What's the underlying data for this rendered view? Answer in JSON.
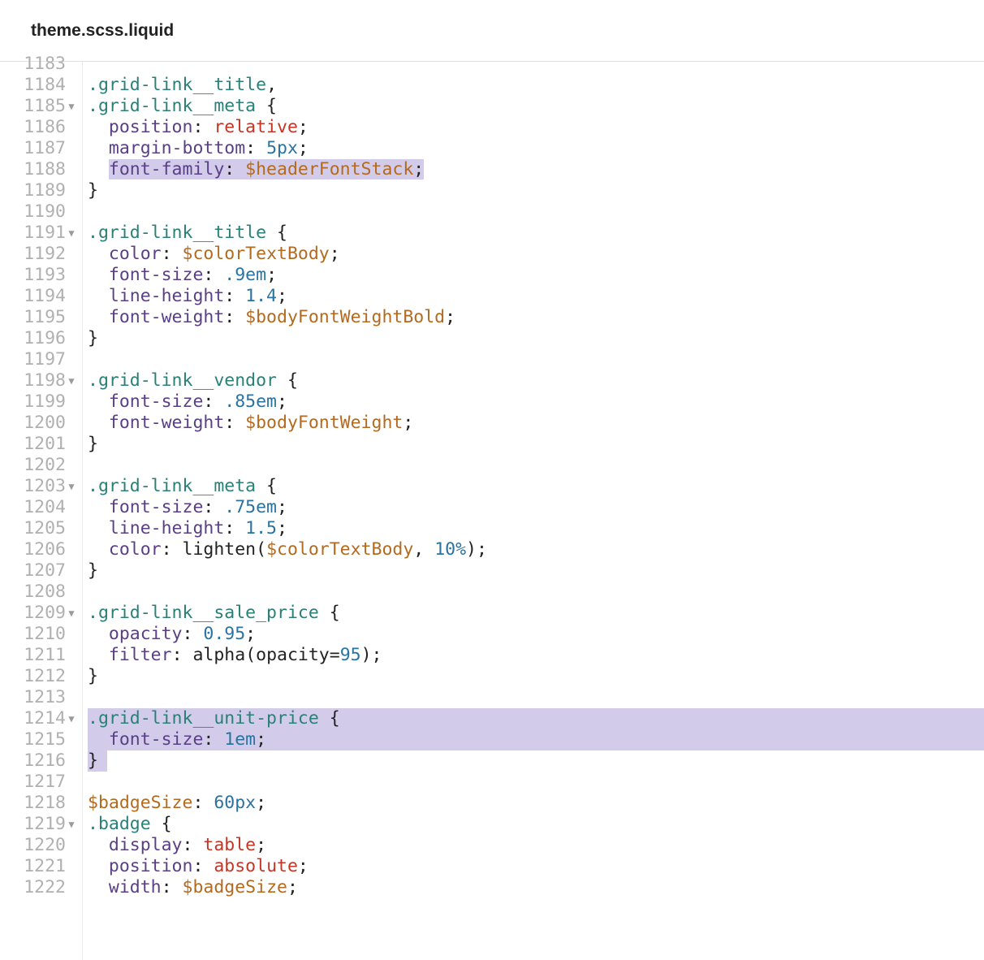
{
  "tab": {
    "title": "theme.scss.liquid"
  },
  "lines": [
    {
      "num": "1183",
      "fold": false,
      "cutTop": true,
      "tokens": []
    },
    {
      "num": "1184",
      "fold": false,
      "tokens": [
        {
          "t": ".grid-link__title",
          "c": "c-sel"
        },
        {
          "t": ",",
          "c": "c-punc"
        }
      ]
    },
    {
      "num": "1185",
      "fold": true,
      "tokens": [
        {
          "t": ".grid-link__meta",
          "c": "c-sel"
        },
        {
          "t": " {",
          "c": "c-punc"
        }
      ]
    },
    {
      "num": "1186",
      "fold": false,
      "tokens": [
        {
          "t": "  ",
          "c": ""
        },
        {
          "t": "position",
          "c": "c-prop"
        },
        {
          "t": ": ",
          "c": "c-punc"
        },
        {
          "t": "relative",
          "c": "c-kw"
        },
        {
          "t": ";",
          "c": "c-punc"
        }
      ]
    },
    {
      "num": "1187",
      "fold": false,
      "tokens": [
        {
          "t": "  ",
          "c": ""
        },
        {
          "t": "margin-bottom",
          "c": "c-prop"
        },
        {
          "t": ": ",
          "c": "c-punc"
        },
        {
          "t": "5px",
          "c": "c-num"
        },
        {
          "t": ";",
          "c": "c-punc"
        }
      ]
    },
    {
      "num": "1188",
      "fold": false,
      "hlInline": true,
      "tokens": [
        {
          "t": "  ",
          "c": ""
        },
        {
          "t": "font-family",
          "c": "c-prop",
          "hl": true
        },
        {
          "t": ": ",
          "c": "c-punc",
          "hl": true
        },
        {
          "t": "$headerFontStack",
          "c": "c-var",
          "hl": true
        },
        {
          "t": ";",
          "c": "c-punc",
          "hl": true
        }
      ]
    },
    {
      "num": "1189",
      "fold": false,
      "tokens": [
        {
          "t": "}",
          "c": "c-punc"
        }
      ]
    },
    {
      "num": "1190",
      "fold": false,
      "tokens": []
    },
    {
      "num": "1191",
      "fold": true,
      "tokens": [
        {
          "t": ".grid-link__title",
          "c": "c-sel"
        },
        {
          "t": " {",
          "c": "c-punc"
        }
      ]
    },
    {
      "num": "1192",
      "fold": false,
      "tokens": [
        {
          "t": "  ",
          "c": ""
        },
        {
          "t": "color",
          "c": "c-prop"
        },
        {
          "t": ": ",
          "c": "c-punc"
        },
        {
          "t": "$colorTextBody",
          "c": "c-var"
        },
        {
          "t": ";",
          "c": "c-punc"
        }
      ]
    },
    {
      "num": "1193",
      "fold": false,
      "tokens": [
        {
          "t": "  ",
          "c": ""
        },
        {
          "t": "font-size",
          "c": "c-prop"
        },
        {
          "t": ": ",
          "c": "c-punc"
        },
        {
          "t": ".9em",
          "c": "c-num"
        },
        {
          "t": ";",
          "c": "c-punc"
        }
      ]
    },
    {
      "num": "1194",
      "fold": false,
      "tokens": [
        {
          "t": "  ",
          "c": ""
        },
        {
          "t": "line-height",
          "c": "c-prop"
        },
        {
          "t": ": ",
          "c": "c-punc"
        },
        {
          "t": "1.4",
          "c": "c-num"
        },
        {
          "t": ";",
          "c": "c-punc"
        }
      ]
    },
    {
      "num": "1195",
      "fold": false,
      "tokens": [
        {
          "t": "  ",
          "c": ""
        },
        {
          "t": "font-weight",
          "c": "c-prop"
        },
        {
          "t": ": ",
          "c": "c-punc"
        },
        {
          "t": "$bodyFontWeightBold",
          "c": "c-var"
        },
        {
          "t": ";",
          "c": "c-punc"
        }
      ]
    },
    {
      "num": "1196",
      "fold": false,
      "tokens": [
        {
          "t": "}",
          "c": "c-punc"
        }
      ]
    },
    {
      "num": "1197",
      "fold": false,
      "tokens": []
    },
    {
      "num": "1198",
      "fold": true,
      "tokens": [
        {
          "t": ".grid-link__vendor",
          "c": "c-sel"
        },
        {
          "t": " {",
          "c": "c-punc"
        }
      ]
    },
    {
      "num": "1199",
      "fold": false,
      "tokens": [
        {
          "t": "  ",
          "c": ""
        },
        {
          "t": "font-size",
          "c": "c-prop"
        },
        {
          "t": ": ",
          "c": "c-punc"
        },
        {
          "t": ".85em",
          "c": "c-num"
        },
        {
          "t": ";",
          "c": "c-punc"
        }
      ]
    },
    {
      "num": "1200",
      "fold": false,
      "tokens": [
        {
          "t": "  ",
          "c": ""
        },
        {
          "t": "font-weight",
          "c": "c-prop"
        },
        {
          "t": ": ",
          "c": "c-punc"
        },
        {
          "t": "$bodyFontWeight",
          "c": "c-var"
        },
        {
          "t": ";",
          "c": "c-punc"
        }
      ]
    },
    {
      "num": "1201",
      "fold": false,
      "tokens": [
        {
          "t": "}",
          "c": "c-punc"
        }
      ]
    },
    {
      "num": "1202",
      "fold": false,
      "tokens": []
    },
    {
      "num": "1203",
      "fold": true,
      "tokens": [
        {
          "t": ".grid-link__meta",
          "c": "c-sel"
        },
        {
          "t": " {",
          "c": "c-punc"
        }
      ]
    },
    {
      "num": "1204",
      "fold": false,
      "tokens": [
        {
          "t": "  ",
          "c": ""
        },
        {
          "t": "font-size",
          "c": "c-prop"
        },
        {
          "t": ": ",
          "c": "c-punc"
        },
        {
          "t": ".75em",
          "c": "c-num"
        },
        {
          "t": ";",
          "c": "c-punc"
        }
      ]
    },
    {
      "num": "1205",
      "fold": false,
      "tokens": [
        {
          "t": "  ",
          "c": ""
        },
        {
          "t": "line-height",
          "c": "c-prop"
        },
        {
          "t": ": ",
          "c": "c-punc"
        },
        {
          "t": "1.5",
          "c": "c-num"
        },
        {
          "t": ";",
          "c": "c-punc"
        }
      ]
    },
    {
      "num": "1206",
      "fold": false,
      "tokens": [
        {
          "t": "  ",
          "c": ""
        },
        {
          "t": "color",
          "c": "c-prop"
        },
        {
          "t": ": ",
          "c": "c-punc"
        },
        {
          "t": "lighten",
          "c": "c-fn"
        },
        {
          "t": "(",
          "c": "c-punc"
        },
        {
          "t": "$colorTextBody",
          "c": "c-var"
        },
        {
          "t": ", ",
          "c": "c-punc"
        },
        {
          "t": "10%",
          "c": "c-num"
        },
        {
          "t": ")",
          "c": "c-punc"
        },
        {
          "t": ";",
          "c": "c-punc"
        }
      ]
    },
    {
      "num": "1207",
      "fold": false,
      "tokens": [
        {
          "t": "}",
          "c": "c-punc"
        }
      ]
    },
    {
      "num": "1208",
      "fold": false,
      "tokens": []
    },
    {
      "num": "1209",
      "fold": true,
      "tokens": [
        {
          "t": ".grid-link__sale_price",
          "c": "c-sel"
        },
        {
          "t": " {",
          "c": "c-punc"
        }
      ]
    },
    {
      "num": "1210",
      "fold": false,
      "tokens": [
        {
          "t": "  ",
          "c": ""
        },
        {
          "t": "opacity",
          "c": "c-prop"
        },
        {
          "t": ": ",
          "c": "c-punc"
        },
        {
          "t": "0.95",
          "c": "c-num"
        },
        {
          "t": ";",
          "c": "c-punc"
        }
      ]
    },
    {
      "num": "1211",
      "fold": false,
      "tokens": [
        {
          "t": "  ",
          "c": ""
        },
        {
          "t": "filter",
          "c": "c-prop"
        },
        {
          "t": ": ",
          "c": "c-punc"
        },
        {
          "t": "alpha",
          "c": "c-fn"
        },
        {
          "t": "(",
          "c": "c-punc"
        },
        {
          "t": "opacity",
          "c": "c-text"
        },
        {
          "t": "=",
          "c": "c-punc"
        },
        {
          "t": "95",
          "c": "c-num"
        },
        {
          "t": ")",
          "c": "c-punc"
        },
        {
          "t": ";",
          "c": "c-punc"
        }
      ]
    },
    {
      "num": "1212",
      "fold": false,
      "tokens": [
        {
          "t": "}",
          "c": "c-punc"
        }
      ]
    },
    {
      "num": "1213",
      "fold": false,
      "tokens": []
    },
    {
      "num": "1214",
      "fold": true,
      "hlBlock": true,
      "tokens": [
        {
          "t": ".grid-link__unit-price",
          "c": "c-sel"
        },
        {
          "t": " {",
          "c": "c-punc"
        }
      ]
    },
    {
      "num": "1215",
      "fold": false,
      "hlBlock": true,
      "tokens": [
        {
          "t": "  ",
          "c": ""
        },
        {
          "t": "font-size",
          "c": "c-prop"
        },
        {
          "t": ": ",
          "c": "c-punc"
        },
        {
          "t": "1em",
          "c": "c-num"
        },
        {
          "t": ";",
          "c": "c-punc"
        }
      ]
    },
    {
      "num": "1216",
      "fold": false,
      "hlBlock3": true,
      "tokens": [
        {
          "t": "}",
          "c": "c-punc"
        }
      ]
    },
    {
      "num": "1217",
      "fold": false,
      "tokens": []
    },
    {
      "num": "1218",
      "fold": false,
      "tokens": [
        {
          "t": "$badgeSize",
          "c": "c-var"
        },
        {
          "t": ": ",
          "c": "c-punc"
        },
        {
          "t": "60px",
          "c": "c-num"
        },
        {
          "t": ";",
          "c": "c-punc"
        }
      ]
    },
    {
      "num": "1219",
      "fold": true,
      "tokens": [
        {
          "t": ".badge",
          "c": "c-sel"
        },
        {
          "t": " {",
          "c": "c-punc"
        }
      ]
    },
    {
      "num": "1220",
      "fold": false,
      "tokens": [
        {
          "t": "  ",
          "c": ""
        },
        {
          "t": "display",
          "c": "c-prop"
        },
        {
          "t": ": ",
          "c": "c-punc"
        },
        {
          "t": "table",
          "c": "c-kw"
        },
        {
          "t": ";",
          "c": "c-punc"
        }
      ]
    },
    {
      "num": "1221",
      "fold": false,
      "tokens": [
        {
          "t": "  ",
          "c": ""
        },
        {
          "t": "position",
          "c": "c-prop"
        },
        {
          "t": ": ",
          "c": "c-punc"
        },
        {
          "t": "absolute",
          "c": "c-kw"
        },
        {
          "t": ";",
          "c": "c-punc"
        }
      ]
    },
    {
      "num": "1222",
      "fold": false,
      "cutBottom": true,
      "tokens": [
        {
          "t": "  ",
          "c": ""
        },
        {
          "t": "width",
          "c": "c-prop"
        },
        {
          "t": ": ",
          "c": "c-punc"
        },
        {
          "t": "$badgeSize",
          "c": "c-var"
        },
        {
          "t": ";",
          "c": "c-punc"
        }
      ]
    }
  ]
}
